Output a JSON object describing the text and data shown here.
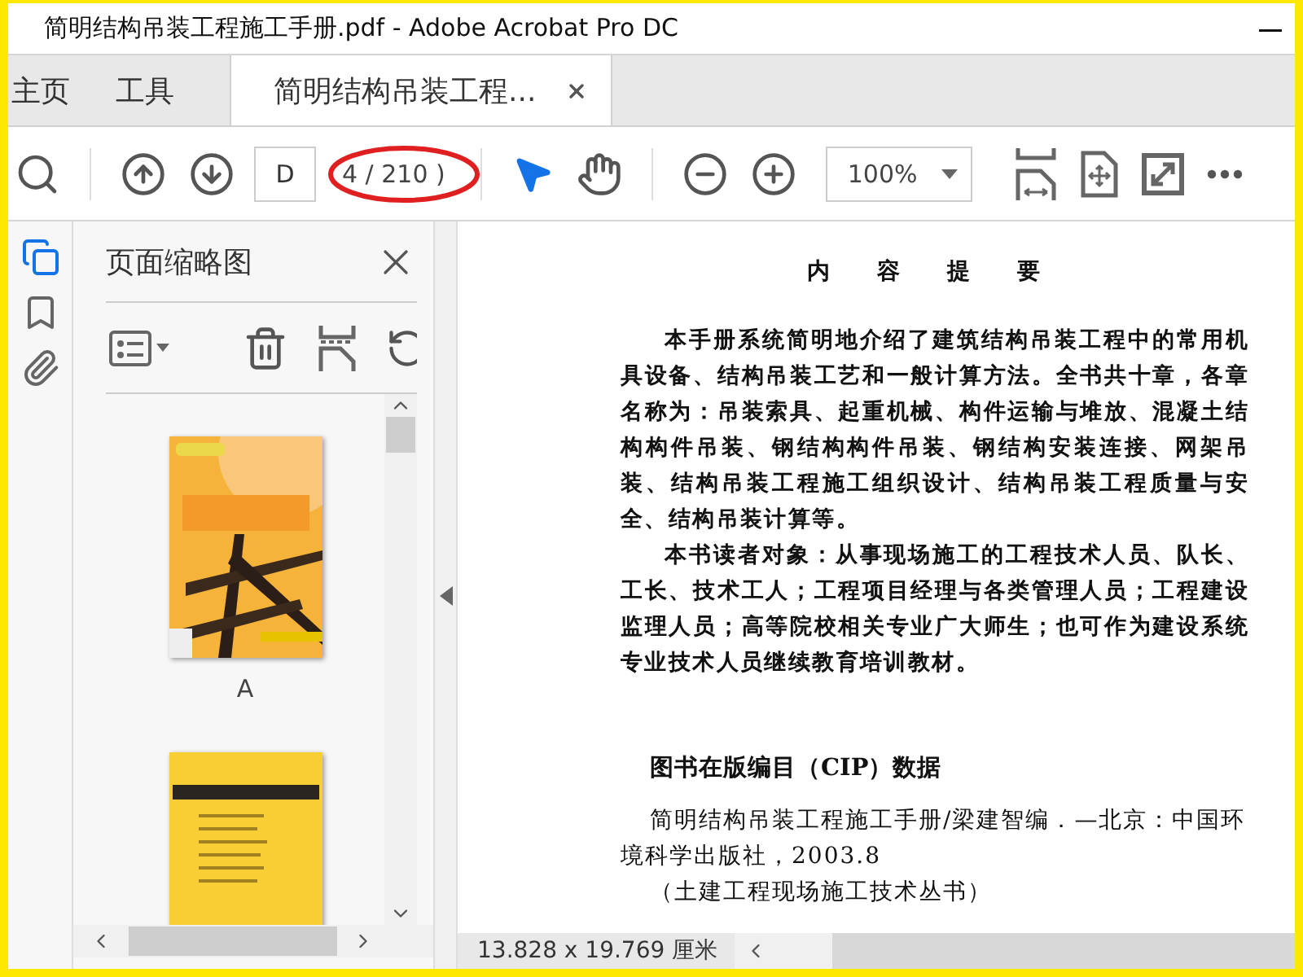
{
  "window": {
    "title": "简明结构吊装工程施工手册.pdf - Adobe Acrobat Pro DC"
  },
  "tabs": [
    {
      "label": "主页",
      "selected": false,
      "closable": false
    },
    {
      "label": "工具",
      "selected": false,
      "closable": false
    },
    {
      "label": "简明结构吊装工程...",
      "selected": true,
      "closable": true
    }
  ],
  "toolbar": {
    "page_field": "D",
    "page_count": "4 / 210 )",
    "page_count_circled": true,
    "zoom": "100%",
    "tools": [
      {
        "kind": "select",
        "selected": true
      },
      {
        "kind": "hand",
        "selected": false
      }
    ]
  },
  "sidebar": {
    "rail": [
      {
        "kind": "pages",
        "selected": true
      },
      {
        "kind": "bookmarks",
        "selected": false
      },
      {
        "kind": "attachments",
        "selected": false
      }
    ],
    "title": "页面缩略图",
    "thumbnails": [
      {
        "kind": "picture",
        "label": "A"
      },
      {
        "kind": "picture"
      }
    ]
  },
  "document": {
    "heading": "内 容 提 要",
    "paragraphs": [
      "本手册系统简明地介绍了建筑结构吊装工程中的常用机具设备、结构吊装工艺和一般计算方法。全书共十章，各章名称为：吊装索具、起重机械、构件运输与堆放、混凝土结构构件吊装、钢结构构件吊装、钢结构安装连接、网架吊装、结构吊装工程施工组织设计、结构吊装工程质量与安全、结构吊装计算等。",
      "本书读者对象：从事现场施工的工程技术人员、队长、工长、技术工人；工程项目经理与各类管理人员；工程建设监理人员；高等院校相关专业广大师生；也可作为建设系统专业技术人员继续教育培训教材。"
    ],
    "cip_heading": "图书在版编目（CIP）数据",
    "cip_lines": [
      "简明结构吊装工程施工手册/梁建智编．—北京：中国环境科学出版社，2003.8",
      "（土建工程现场施工技术丛书）"
    ]
  },
  "status_bar": {
    "page_size": "13.828 x 19.769 厘米"
  }
}
